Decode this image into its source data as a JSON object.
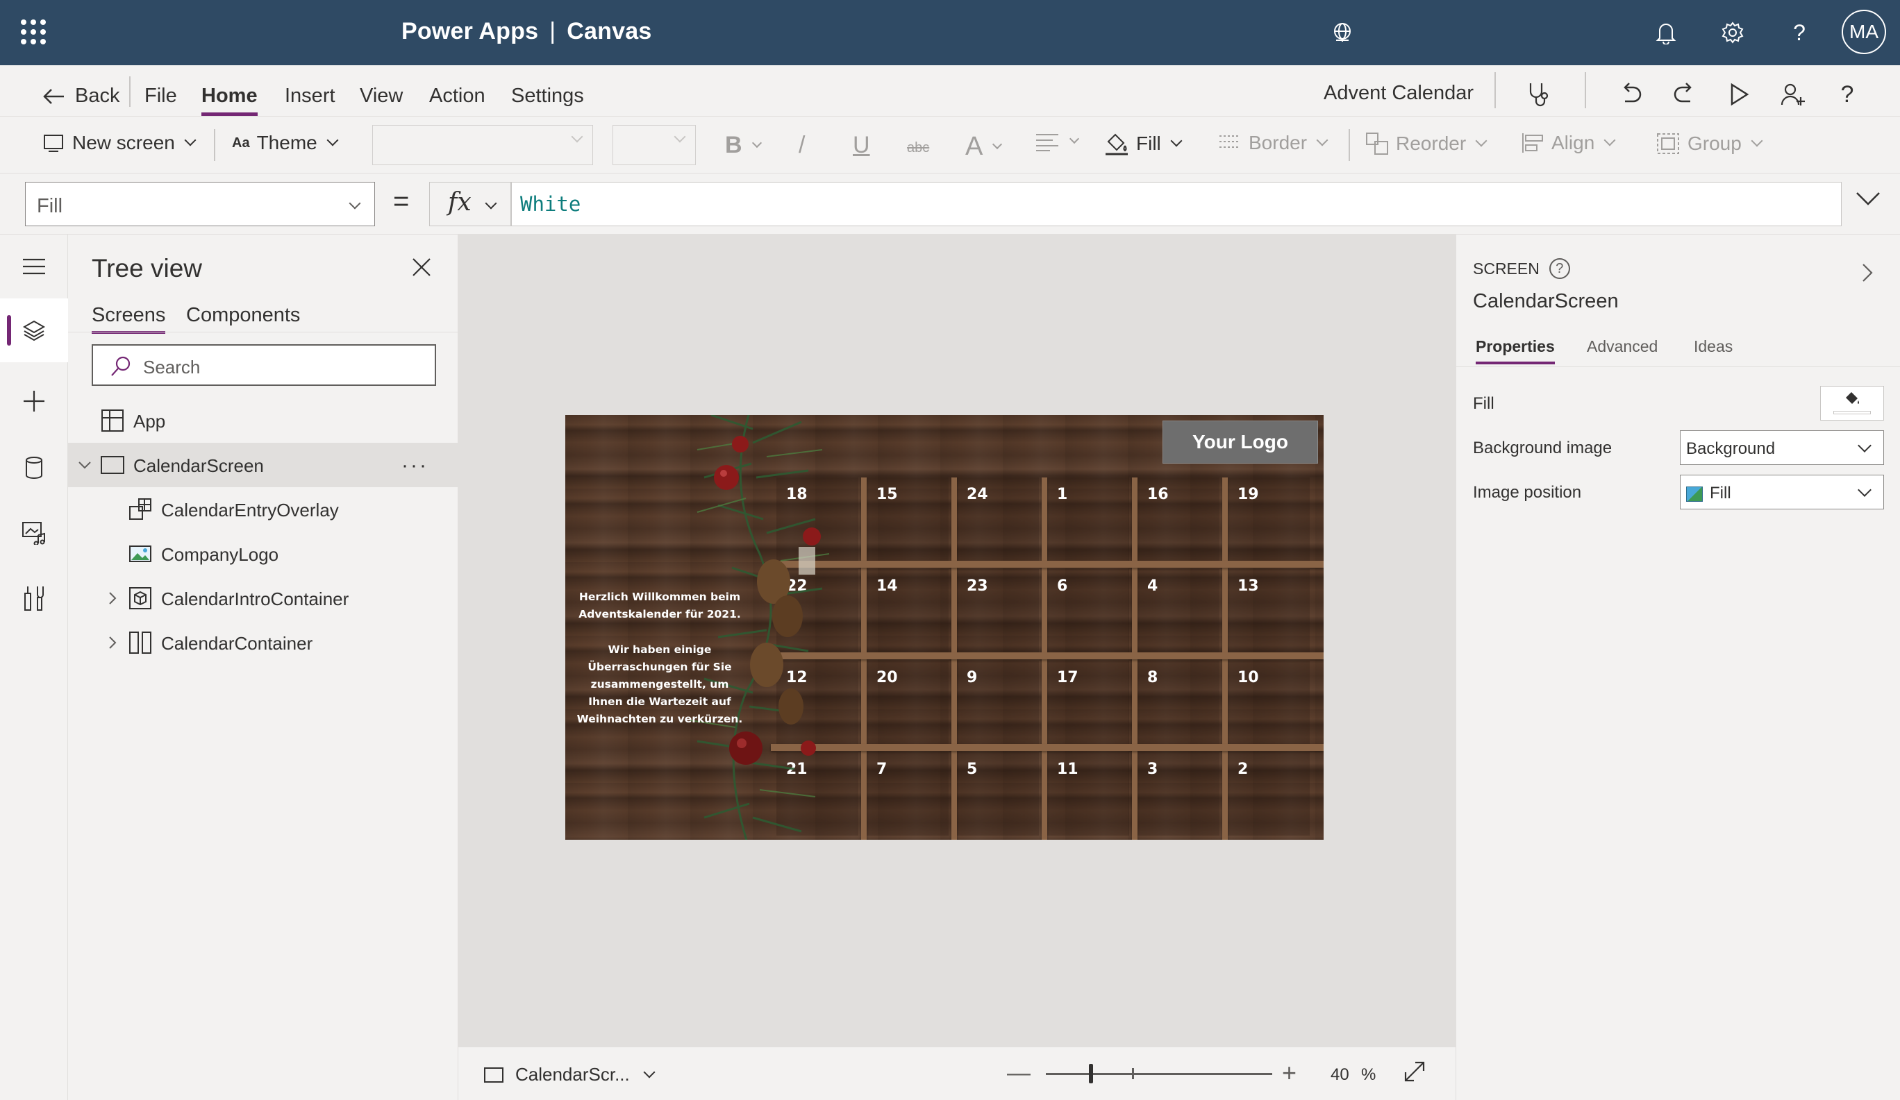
{
  "header": {
    "app_name": "Power Apps",
    "separator": "|",
    "app_type": "Canvas",
    "user_initials": "MA",
    "icons": [
      "app-launcher-icon",
      "environment-globe-icon",
      "notifications-icon",
      "settings-icon",
      "help-icon"
    ]
  },
  "menu": {
    "back_label": "Back",
    "items": [
      "File",
      "Home",
      "Insert",
      "View",
      "Action",
      "Settings"
    ],
    "active_item": "Home",
    "document_name": "Advent Calendar",
    "icons": [
      "app-checker-icon",
      "undo-icon",
      "redo-icon",
      "preview-play-icon",
      "share-icon",
      "help-icon"
    ]
  },
  "ribbon": {
    "new_screen": "New screen",
    "theme": "Theme",
    "bold": "B",
    "italic": "/",
    "underline": "U",
    "strikethrough": "abc",
    "font_size": "A",
    "fill": "Fill",
    "border": "Border",
    "reorder": "Reorder",
    "align": "Align",
    "group": "Group"
  },
  "formula": {
    "property": "Fill",
    "equals": "=",
    "fx": "fx",
    "value": "White"
  },
  "left_rail": {
    "items": [
      "hamburger-menu-icon",
      "tree-view-layers-icon",
      "insert-plus-icon",
      "data-cylinder-icon",
      "media-icon",
      "advanced-tools-icon"
    ],
    "active": "tree-view-layers-icon"
  },
  "tree_view": {
    "title": "Tree view",
    "tabs": [
      "Screens",
      "Components"
    ],
    "active_tab": "Screens",
    "search_placeholder": "Search",
    "nodes": [
      {
        "label": "App",
        "icon": "app-icon",
        "level": 0
      },
      {
        "label": "CalendarScreen",
        "icon": "screen-icon",
        "level": 0,
        "expanded": true,
        "selected": true,
        "more": "···"
      },
      {
        "label": "CalendarEntryOverlay",
        "icon": "group-layout-icon",
        "level": 1
      },
      {
        "label": "CompanyLogo",
        "icon": "image-icon",
        "level": 1
      },
      {
        "label": "CalendarIntroContainer",
        "icon": "container-icon",
        "level": 1,
        "collapsed": true
      },
      {
        "label": "CalendarContainer",
        "icon": "horizontal-container-icon",
        "level": 1,
        "collapsed": true
      }
    ]
  },
  "canvas": {
    "logo_text": "Your Logo",
    "intro_line1": "Herzlich Willkommen beim Adventskalender für 2021.",
    "intro_line2": "Wir haben einige Überraschungen für Sie zusammengestellt, um Ihnen die Wartezeit auf Weihnachten zu verkürzen.",
    "calendar_rows": [
      [
        "18",
        "15",
        "24",
        "1",
        "16",
        "19"
      ],
      [
        "22",
        "14",
        "23",
        "6",
        "4",
        "13"
      ],
      [
        "12",
        "20",
        "9",
        "17",
        "8",
        "10"
      ],
      [
        "21",
        "7",
        "5",
        "11",
        "3",
        "2"
      ]
    ]
  },
  "status_bar": {
    "screen_name": "CalendarScr...",
    "zoom_minus": "—",
    "zoom_plus": "+",
    "zoom_value": "40",
    "zoom_unit": "%",
    "zoom_fraction": 0.4
  },
  "properties": {
    "type_label": "SCREEN",
    "help": "?",
    "name": "CalendarScreen",
    "tabs": [
      "Properties",
      "Advanced",
      "Ideas"
    ],
    "active_tab": "Properties",
    "fill_label": "Fill",
    "fill_color": "#ffffff",
    "background_image_label": "Background image",
    "background_image_value": "Background",
    "image_position_label": "Image position",
    "image_position_value": "Fill"
  },
  "colors": {
    "header_bg": "#2f4a64",
    "accent": "#742774",
    "formula_text": "#0e7d7d",
    "canvas_bg": "#e1dfdd"
  }
}
